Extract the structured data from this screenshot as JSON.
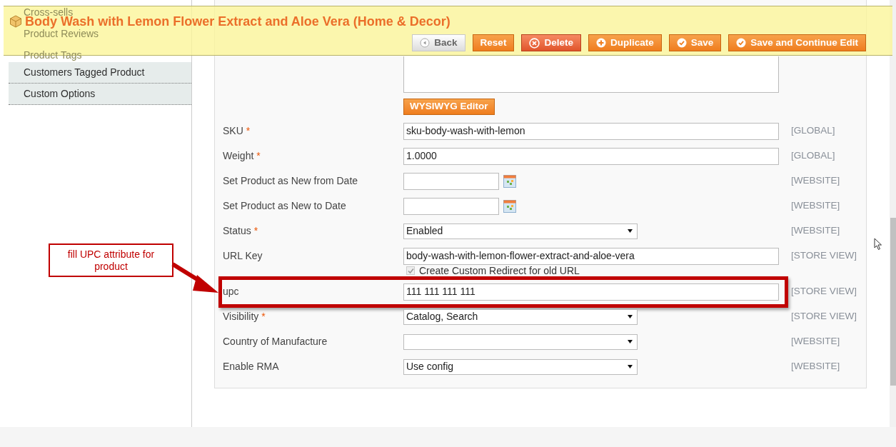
{
  "header": {
    "title": "Body Wash with Lemon Flower Extract and Aloe Vera (Home & Decor)",
    "buttons": [
      {
        "label": "Back",
        "kind": "back"
      },
      {
        "label": "Reset",
        "kind": "plain"
      },
      {
        "label": "Delete",
        "kind": "delete"
      },
      {
        "label": "Duplicate",
        "kind": "add"
      },
      {
        "label": "Save",
        "kind": "check"
      },
      {
        "label": "Save and Continue Edit",
        "kind": "check"
      }
    ]
  },
  "sidebar": {
    "items": [
      {
        "label": "Cross-sells",
        "dimmed": true
      },
      {
        "label": "Product Reviews",
        "dimmed": true
      },
      {
        "label": "Product Tags",
        "dimmed": true
      },
      {
        "label": "Customers Tagged Product",
        "dimmed": false
      },
      {
        "label": "Custom Options",
        "dimmed": false
      }
    ]
  },
  "editor_button": "WYSIWYG Editor",
  "fields": [
    {
      "label": "SKU",
      "required_mark": "*",
      "kind": "text",
      "value": "sku-body-wash-with-lemon",
      "scope": "[GLOBAL]",
      "highlighted": false
    },
    {
      "label": "Weight",
      "required_mark": "*",
      "kind": "text",
      "value": "1.0000",
      "scope": "[GLOBAL]",
      "highlighted": false
    },
    {
      "label": "Set Product as New from Date",
      "kind": "date",
      "scope": "[WEBSITE]",
      "highlighted": false
    },
    {
      "label": "Set Product as New to Date",
      "kind": "date",
      "scope": "[WEBSITE]",
      "highlighted": false
    },
    {
      "label": "Status",
      "required_mark": "*",
      "kind": "select",
      "value": "Enabled",
      "scope": "[WEBSITE]",
      "highlighted": false
    },
    {
      "label": "URL Key",
      "kind": "text",
      "value": "body-wash-with-lemon-flower-extract-and-aloe-vera",
      "scope": "[STORE VIEW]",
      "highlighted": false,
      "option": {
        "label": "Create Custom Redirect for old URL",
        "checked": true
      }
    },
    {
      "label": "upc",
      "kind": "text",
      "value": "111 111 111 111",
      "scope": "[STORE VIEW]",
      "highlighted": true
    },
    {
      "label": "Visibility",
      "required_mark": "*",
      "kind": "select",
      "value": "Catalog, Search",
      "scope": "[STORE VIEW]",
      "highlighted": false
    },
    {
      "label": "Country of Manufacture",
      "kind": "select",
      "scope": "[WEBSITE]",
      "highlighted": false
    },
    {
      "label": "Enable RMA",
      "kind": "select",
      "value": "Use config",
      "scope": "[WEBSITE]",
      "highlighted": false
    }
  ],
  "annotation": {
    "text": "fill UPC attribute for product"
  }
}
